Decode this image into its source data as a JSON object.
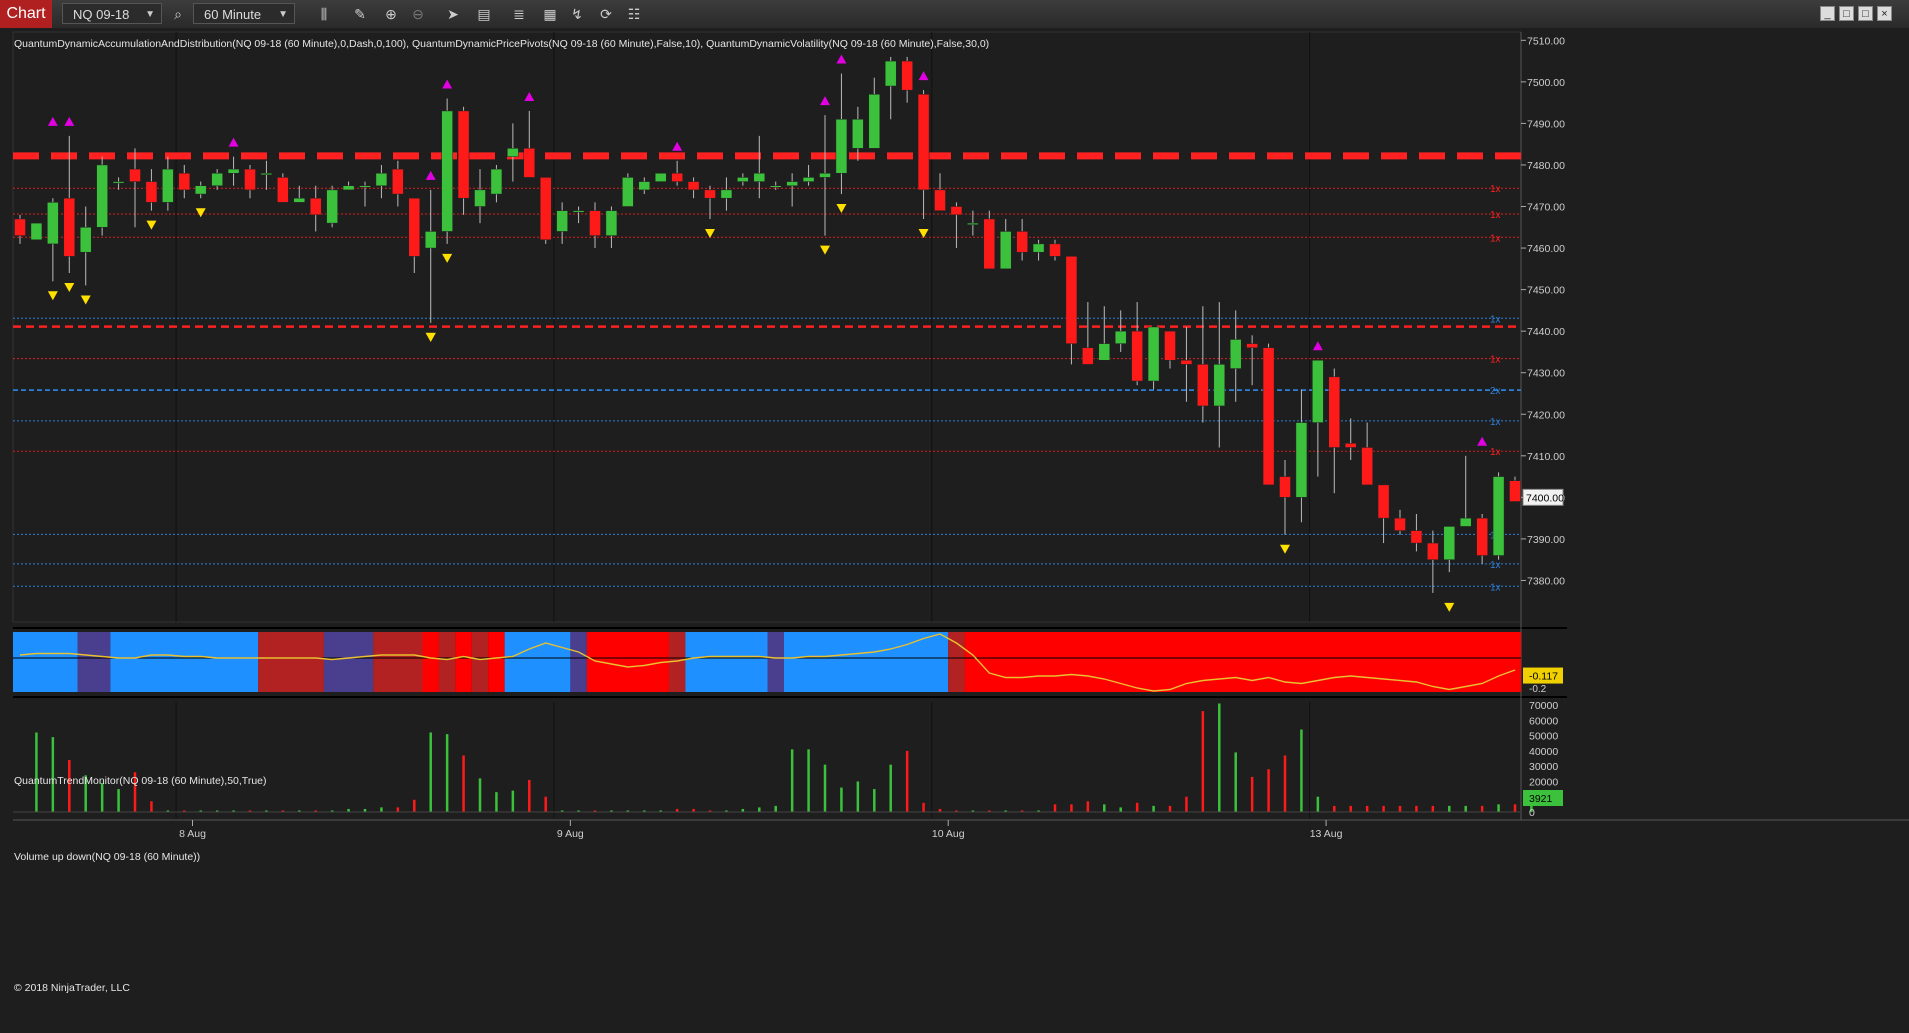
{
  "toolbar": {
    "tab_label": "Chart",
    "instrument": "NQ 09-18",
    "interval": "60 Minute",
    "icons": [
      "search-icon",
      "bars-icon",
      "pencil-icon",
      "zoom-in-icon",
      "zoom-out-icon",
      "pointer-icon",
      "properties-icon",
      "strategies-icon",
      "templates-icon",
      "drawing-icon",
      "reload-icon",
      "data-box-icon"
    ]
  },
  "window_buttons": [
    "_",
    "□",
    "□",
    "×"
  ],
  "indicators_label": "QuantumDynamicAccumulationAndDistribution(NQ 09-18 (60 Minute),0,Dash,0,100), QuantumDynamicPricePivots(NQ 09-18 (60 Minute),False,10), QuantumDynamicVolatility(NQ 09-18 (60 Minute),False,30,0)",
  "trend_panel_label": "QuantumTrendMonitor(NQ 09-18 (60 Minute),50,True)",
  "volume_panel_label": "Volume up down(NQ 09-18 (60 Minute))",
  "copyright": "© 2018 NinjaTrader, LLC",
  "colors": {
    "background": "#1e1e1e",
    "up": "#3cc13c",
    "down": "#ff1a1a",
    "resistance": "#ff2020",
    "support": "#2e7fd8",
    "pivot_high": "#e000e0",
    "pivot_low": "#ffe000",
    "trend_bull": "#1e90ff",
    "trend_bear": "#ff0000",
    "trend_weak_bull": "#4a3f8f",
    "trend_weak_bear": "#b22222",
    "trend_line": "#e8c030"
  },
  "chart_data": {
    "type": "candlestick",
    "instrument": "NQ 09-18",
    "interval": "60 Minute",
    "ylim": [
      7370,
      7512
    ],
    "y_ticks": [
      7510,
      7500,
      7490,
      7480,
      7470,
      7460,
      7450,
      7440,
      7430,
      7420,
      7410,
      7400,
      7390,
      7380
    ],
    "y_tick_labels": [
      "7510.00",
      "7500.00",
      "7490.00",
      "7480.00",
      "7470.00",
      "7460.00",
      "7450.00",
      "7440.00",
      "7430.00",
      "7420.00",
      "7410.00",
      "7400.00",
      "7390.00",
      "7380.00"
    ],
    "last_price_label": "7400.00",
    "last_price": 7400,
    "x_labels": [
      {
        "label": "8 Aug",
        "bar": 10.5
      },
      {
        "label": "9 Aug",
        "bar": 33.5
      },
      {
        "label": "10 Aug",
        "bar": 56.5
      },
      {
        "label": "13 Aug",
        "bar": 79.5
      }
    ],
    "candles": [
      [
        7467,
        7468,
        7461,
        7463
      ],
      [
        7462,
        7466,
        7462,
        7466
      ],
      [
        7461,
        7472,
        7452,
        7471
      ],
      [
        7472,
        7487,
        7454,
        7458
      ],
      [
        7459,
        7470,
        7451,
        7465
      ],
      [
        7465,
        7482,
        7463,
        7480
      ],
      [
        7476,
        7477,
        7474,
        7476
      ],
      [
        7479,
        7484,
        7465,
        7476
      ],
      [
        7476,
        7479,
        7469,
        7471
      ],
      [
        7471,
        7482,
        7469,
        7479
      ],
      [
        7478,
        7480,
        7472,
        7474
      ],
      [
        7473,
        7476,
        7472,
        7475
      ],
      [
        7475,
        7479,
        7474,
        7478
      ],
      [
        7478,
        7482,
        7475,
        7479
      ],
      [
        7479,
        7480,
        7472,
        7474
      ],
      [
        7478,
        7481,
        7474,
        7478
      ],
      [
        7477,
        7478,
        7472,
        7471
      ],
      [
        7471,
        7475,
        7471,
        7472
      ],
      [
        7472,
        7475,
        7464,
        7468
      ],
      [
        7466,
        7475,
        7465,
        7474
      ],
      [
        7474,
        7476,
        7474,
        7475
      ],
      [
        7475,
        7476,
        7470,
        7475
      ],
      [
        7475,
        7480,
        7472,
        7478
      ],
      [
        7479,
        7481,
        7470,
        7473
      ],
      [
        7472,
        7470,
        7454,
        7458
      ],
      [
        7460,
        7474,
        7442,
        7464
      ],
      [
        7464,
        7496,
        7461,
        7493
      ],
      [
        7493,
        7494,
        7468,
        7472
      ],
      [
        7470,
        7479,
        7466,
        7474
      ],
      [
        7473,
        7480,
        7471,
        7479
      ],
      [
        7482,
        7490,
        7476,
        7484
      ],
      [
        7484,
        7493,
        7478,
        7477
      ],
      [
        7477,
        7477,
        7461,
        7462
      ],
      [
        7464,
        7471,
        7461,
        7469
      ],
      [
        7469,
        7470,
        7466,
        7469
      ],
      [
        7469,
        7471,
        7460,
        7463
      ],
      [
        7463,
        7470,
        7460,
        7469
      ],
      [
        7470,
        7478,
        7470,
        7477
      ],
      [
        7474,
        7477,
        7473,
        7476
      ],
      [
        7476,
        7478,
        7476,
        7478
      ],
      [
        7478,
        7481,
        7475,
        7476
      ],
      [
        7476,
        7477,
        7472,
        7474
      ],
      [
        7474,
        7475,
        7467,
        7472
      ],
      [
        7472,
        7477,
        7469,
        7474
      ],
      [
        7476,
        7478,
        7475,
        7477
      ],
      [
        7476,
        7487,
        7472,
        7478
      ],
      [
        7475,
        7476,
        7474,
        7475
      ],
      [
        7475,
        7478,
        7470,
        7476
      ],
      [
        7476,
        7480,
        7475,
        7477
      ],
      [
        7477,
        7492,
        7463,
        7478
      ],
      [
        7478,
        7502,
        7473,
        7491
      ],
      [
        7484,
        7494,
        7481,
        7491
      ],
      [
        7484,
        7501,
        7484,
        7497
      ],
      [
        7499,
        7506,
        7491,
        7505
      ],
      [
        7505,
        7506,
        7495,
        7498
      ],
      [
        7497,
        7498,
        7467,
        7474
      ],
      [
        7474,
        7478,
        7470,
        7469
      ],
      [
        7470,
        7471,
        7460,
        7468
      ],
      [
        7466,
        7469,
        7463,
        7466
      ],
      [
        7467,
        7469,
        7455,
        7455
      ],
      [
        7455,
        7467,
        7455,
        7464
      ],
      [
        7464,
        7467,
        7457,
        7459
      ],
      [
        7459,
        7462,
        7457,
        7461
      ],
      [
        7461,
        7462,
        7457,
        7458
      ],
      [
        7458,
        7458,
        7432,
        7437
      ],
      [
        7436,
        7447,
        7432,
        7432
      ],
      [
        7433,
        7446,
        7433,
        7437
      ],
      [
        7437,
        7445,
        7435,
        7440
      ],
      [
        7440,
        7447,
        7427,
        7428
      ],
      [
        7428,
        7440,
        7426,
        7441
      ],
      [
        7440,
        7440,
        7431,
        7433
      ],
      [
        7433,
        7441,
        7423,
        7432
      ],
      [
        7432,
        7446,
        7418,
        7422
      ],
      [
        7422,
        7447,
        7412,
        7432
      ],
      [
        7431,
        7445,
        7423,
        7438
      ],
      [
        7437,
        7439,
        7427,
        7436
      ],
      [
        7436,
        7437,
        7405,
        7403
      ],
      [
        7405,
        7409,
        7391,
        7400
      ],
      [
        7400,
        7426,
        7394,
        7418
      ],
      [
        7418,
        7433,
        7405,
        7433
      ],
      [
        7429,
        7431,
        7401,
        7412
      ],
      [
        7413,
        7419,
        7409,
        7412
      ],
      [
        7412,
        7418,
        7403,
        7403
      ],
      [
        7403,
        7403,
        7389,
        7395
      ],
      [
        7395,
        7397,
        7391,
        7392
      ],
      [
        7392,
        7396,
        7387,
        7389
      ],
      [
        7389,
        7392,
        7377,
        7385
      ],
      [
        7385,
        7393,
        7382,
        7393
      ],
      [
        7393,
        7410,
        7394,
        7395
      ],
      [
        7395,
        7396,
        7384,
        7386
      ],
      [
        7386,
        7406,
        7385,
        7405
      ],
      [
        7404,
        7405,
        7399,
        7399
      ]
    ],
    "resistance_levels": [
      {
        "price": 7482.2,
        "style": "bold-dash"
      },
      {
        "price": 7441.1,
        "style": "dash"
      },
      {
        "price": 7474.4,
        "style": "dotted",
        "label": "1x"
      },
      {
        "price": 7468.2,
        "style": "dotted",
        "label": "1x"
      },
      {
        "price": 7462.6,
        "style": "dotted",
        "label": "1x"
      },
      {
        "price": 7433.4,
        "style": "dotted",
        "label": "1x"
      },
      {
        "price": 7411.1,
        "style": "dotted",
        "label": "1x"
      }
    ],
    "support_levels": [
      {
        "price": 7443.1,
        "style": "dotted",
        "label": "1x"
      },
      {
        "price": 7425.8,
        "style": "dash",
        "label": "2x"
      },
      {
        "price": 7418.4,
        "style": "dotted",
        "label": "1x"
      },
      {
        "price": 7391.1,
        "style": "dotted",
        "label": "1x"
      },
      {
        "price": 7384.0,
        "style": "dotted",
        "label": "1x"
      },
      {
        "price": 7378.6,
        "style": "dotted",
        "label": "1x"
      }
    ],
    "pivot_markers": [
      {
        "bar": 2,
        "kind": "high",
        "price": 7487
      },
      {
        "bar": 2,
        "kind": "low",
        "price": 7452
      },
      {
        "bar": 3,
        "kind": "high",
        "price": 7487
      },
      {
        "bar": 3,
        "kind": "low",
        "price": 7454
      },
      {
        "bar": 4,
        "kind": "low",
        "price": 7451
      },
      {
        "bar": 8,
        "kind": "low",
        "price": 7469
      },
      {
        "bar": 11,
        "kind": "low",
        "price": 7472
      },
      {
        "bar": 13,
        "kind": "high",
        "price": 7482
      },
      {
        "bar": 25,
        "kind": "high",
        "price": 7474
      },
      {
        "bar": 25,
        "kind": "low",
        "price": 7442
      },
      {
        "bar": 25,
        "kind": "low",
        "price": 7442
      },
      {
        "bar": 26,
        "kind": "high",
        "price": 7496
      },
      {
        "bar": 26,
        "kind": "low",
        "price": 7461
      },
      {
        "bar": 31,
        "kind": "high",
        "price": 7493
      },
      {
        "bar": 40,
        "kind": "high",
        "price": 7481
      },
      {
        "bar": 42,
        "kind": "low",
        "price": 7467
      },
      {
        "bar": 49,
        "kind": "high",
        "price": 7492
      },
      {
        "bar": 49,
        "kind": "low",
        "price": 7463
      },
      {
        "bar": 50,
        "kind": "high",
        "price": 7502
      },
      {
        "bar": 50,
        "kind": "low",
        "price": 7473
      },
      {
        "bar": 55,
        "kind": "high",
        "price": 7498
      },
      {
        "bar": 55,
        "kind": "low",
        "price": 7467
      },
      {
        "bar": 77,
        "kind": "low",
        "price": 7391
      },
      {
        "bar": 79,
        "kind": "high",
        "price": 7433
      },
      {
        "bar": 87,
        "kind": "low",
        "price": 7377
      },
      {
        "bar": 89,
        "kind": "high",
        "price": 7410
      }
    ],
    "trend_monitor": {
      "label_value": "-0.117",
      "lower_label": "-0.2",
      "segments": [
        {
          "from": 0,
          "to": 4,
          "state": "bull"
        },
        {
          "from": 4,
          "to": 6,
          "state": "weak_bull"
        },
        {
          "from": 6,
          "to": 15,
          "state": "bull"
        },
        {
          "from": 15,
          "to": 19,
          "state": "weak_bear"
        },
        {
          "from": 19,
          "to": 22,
          "state": "weak_bull"
        },
        {
          "from": 22,
          "to": 25,
          "state": "weak_bear"
        },
        {
          "from": 25,
          "to": 26,
          "state": "bear"
        },
        {
          "from": 26,
          "to": 27,
          "state": "weak_bear"
        },
        {
          "from": 27,
          "to": 28,
          "state": "bear"
        },
        {
          "from": 28,
          "to": 29,
          "state": "weak_bear"
        },
        {
          "from": 29,
          "to": 30,
          "state": "bear"
        },
        {
          "from": 30,
          "to": 34,
          "state": "bull"
        },
        {
          "from": 34,
          "to": 35,
          "state": "weak_bull"
        },
        {
          "from": 35,
          "to": 40,
          "state": "bear"
        },
        {
          "from": 40,
          "to": 41,
          "state": "weak_bear"
        },
        {
          "from": 41,
          "to": 46,
          "state": "bull"
        },
        {
          "from": 46,
          "to": 47,
          "state": "weak_bull"
        },
        {
          "from": 47,
          "to": 57,
          "state": "bull"
        },
        {
          "from": 57,
          "to": 58,
          "state": "weak_bear"
        },
        {
          "from": 58,
          "to": 92,
          "state": "bear"
        }
      ],
      "line": [
        0.02,
        0.03,
        0.03,
        0.03,
        0.02,
        0.01,
        0.0,
        0.0,
        0.02,
        0.02,
        0.01,
        0.01,
        0.0,
        0.0,
        0.0,
        0.0,
        0.0,
        0.0,
        0.0,
        -0.01,
        0.0,
        0.01,
        0.02,
        0.02,
        0.02,
        0.0,
        -0.01,
        0.01,
        -0.01,
        0.0,
        0.01,
        0.06,
        0.1,
        0.07,
        0.04,
        -0.02,
        -0.04,
        -0.06,
        -0.05,
        -0.03,
        -0.02,
        0.0,
        0.01,
        0.01,
        0.01,
        0.01,
        0.0,
        0.0,
        0.01,
        0.01,
        0.02,
        0.03,
        0.04,
        0.06,
        0.09,
        0.13,
        0.16,
        0.1,
        0.02,
        -0.1,
        -0.13,
        -0.13,
        -0.12,
        -0.12,
        -0.11,
        -0.12,
        -0.14,
        -0.17,
        -0.2,
        -0.22,
        -0.21,
        -0.17,
        -0.15,
        -0.14,
        -0.13,
        -0.15,
        -0.13,
        -0.16,
        -0.17,
        -0.15,
        -0.13,
        -0.12,
        -0.13,
        -0.14,
        -0.15,
        -0.16,
        -0.19,
        -0.21,
        -0.19,
        -0.17,
        -0.12,
        -0.08
      ]
    },
    "volume": {
      "ylim": [
        0,
        72000
      ],
      "y_tick_labels": [
        "70000",
        "60000",
        "50000",
        "40000",
        "30000",
        "20000",
        "10000",
        "0"
      ],
      "y_ticks": [
        70000,
        60000,
        50000,
        40000,
        30000,
        20000,
        10000,
        0
      ],
      "last_label": "3921",
      "values": [
        0,
        52000,
        49000,
        34000,
        24000,
        19000,
        15000,
        26000,
        7000,
        1000,
        1000,
        1000,
        1000,
        1000,
        1000,
        1000,
        1000,
        1000,
        1000,
        1000,
        2000,
        2000,
        3000,
        3000,
        8000,
        52000,
        51000,
        37000,
        22000,
        13000,
        14000,
        21000,
        10000,
        1000,
        1000,
        1000,
        1000,
        1000,
        1000,
        1000,
        2000,
        2000,
        1000,
        1000,
        2000,
        3000,
        4000,
        41000,
        41000,
        31000,
        16000,
        20000,
        15000,
        31000,
        40000,
        6000,
        2000,
        1000,
        1000,
        1000,
        1000,
        1000,
        1000,
        5000,
        5000,
        7000,
        5000,
        3000,
        6000,
        4000,
        4000,
        10000,
        66000,
        71000,
        39000,
        23000,
        28000,
        37000,
        54000,
        10000,
        4000,
        4000,
        4000,
        4000,
        4000,
        4000,
        4000,
        4000,
        4000,
        4000,
        5000,
        5000,
        3921
      ]
    }
  }
}
